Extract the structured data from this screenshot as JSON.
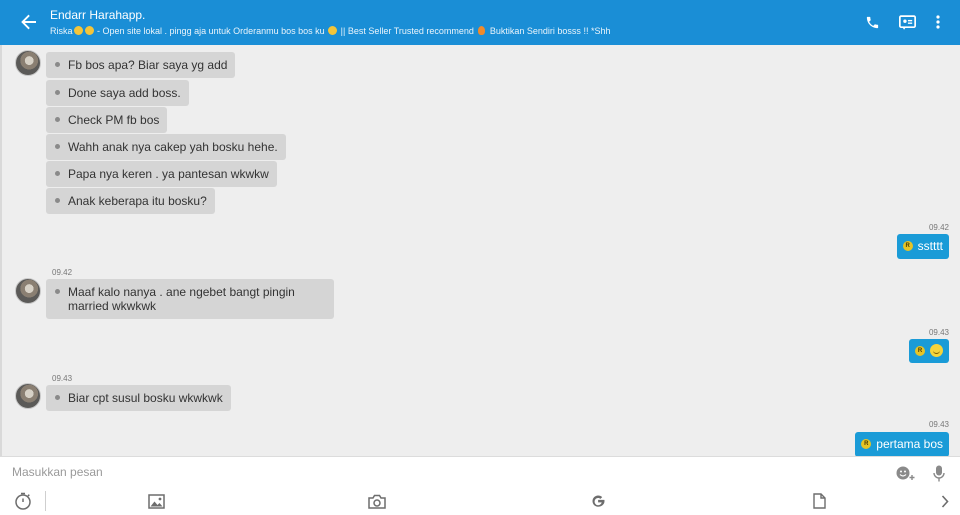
{
  "header": {
    "title": "Endarr Harahapp.",
    "subtitle_parts": [
      "Riska",
      " - Open site lokal . pingg aja untuk Orderanmu bos bos ku ",
      " || Best Seller Trusted recommend ",
      " Buktikan Sendiri bosss !! *Shh"
    ]
  },
  "messages": {
    "m1": "Fb bos apa? Biar saya yg add",
    "m2": "Done saya add boss.",
    "m3": "Check PM fb bos",
    "m4": "Wahh anak nya cakep yah bosku hehe.",
    "m5": "Papa nya keren . ya pantesan wkwkw",
    "m6": "Anak keberapa itu bosku?",
    "o1_time": "09.42",
    "o1_text": "sstttt",
    "t_in2": "09.42",
    "m7": "Maaf kalo nanya . ane ngebet bangt pingin married wkwkwk",
    "o2_time": "09.43",
    "t_in3": "09.43",
    "m8": "Biar cpt susul bosku wkwkwk",
    "o3_time": "09.43",
    "o3_text": "pertama bos",
    "sender_badge": "R"
  },
  "composer": {
    "placeholder": "Masukkan pesan"
  },
  "icons": {
    "back": "arrow-left-icon",
    "call": "phone-icon",
    "card": "contact-card-icon",
    "menu": "more-vert-icon",
    "emoji_add": "emoji-plus-icon",
    "mic": "microphone-icon",
    "timer": "timer-icon",
    "gallery": "image-icon",
    "camera": "camera-icon",
    "google": "google-icon",
    "file": "file-icon",
    "next": "chevron-right-icon"
  },
  "colors": {
    "header": "#1a8ed6",
    "outgoing_bubble": "#1a9bd7",
    "incoming_bubble": "#d5d5d5",
    "background": "#eeeeee"
  }
}
